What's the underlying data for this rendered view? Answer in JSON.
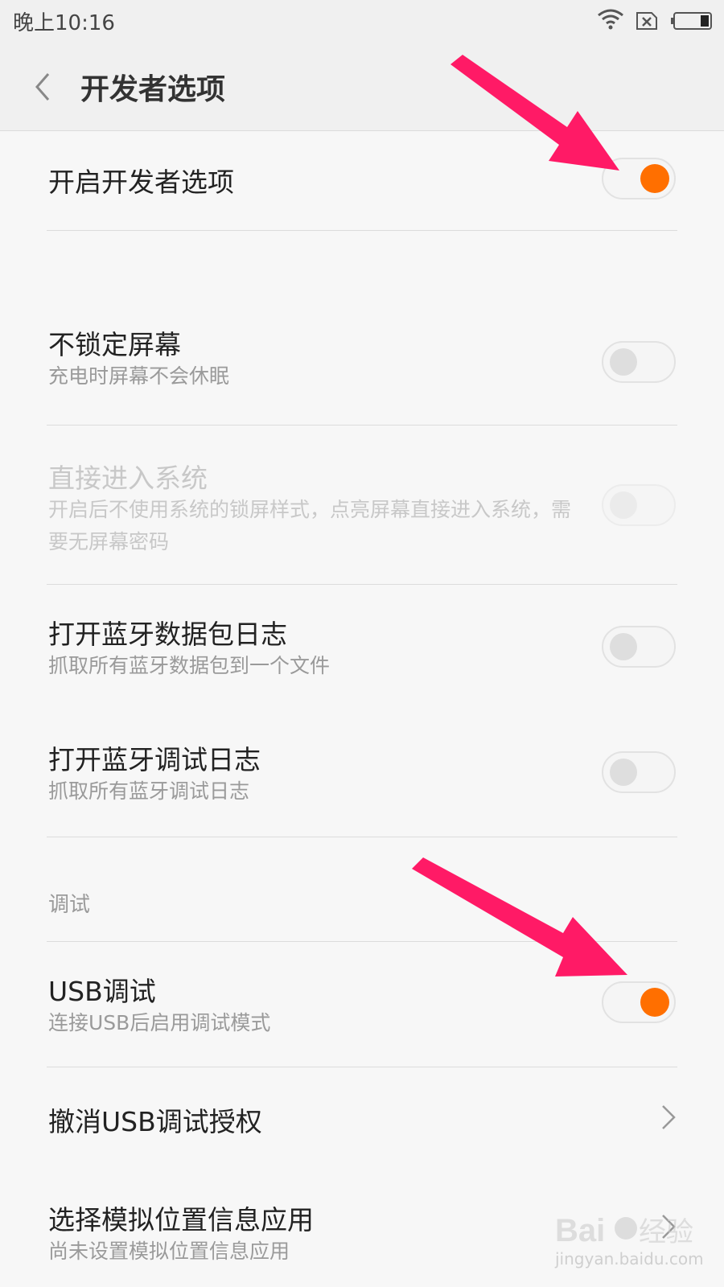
{
  "status_bar": {
    "time": "晚上10:16"
  },
  "header": {
    "title": "开发者选项"
  },
  "settings": {
    "enable_dev": {
      "label": "开启开发者选项",
      "state": "on"
    },
    "stay_awake": {
      "label": "不锁定屏幕",
      "desc": "充电时屏幕不会休眠",
      "state": "off"
    },
    "direct_entry": {
      "label": "直接进入系统",
      "desc": "开启后不使用系统的锁屏样式，点亮屏幕直接进入系统，需要无屏幕密码",
      "state": "off",
      "enabled": false
    },
    "bt_packet_log": {
      "label": "打开蓝牙数据包日志",
      "desc": "抓取所有蓝牙数据包到一个文件",
      "state": "off"
    },
    "bt_debug_log": {
      "label": "打开蓝牙调试日志",
      "desc": "抓取所有蓝牙调试日志",
      "state": "off"
    },
    "debug_section": "调试",
    "usb_debugging": {
      "label": "USB调试",
      "desc": "连接USB后启用调试模式",
      "state": "on"
    },
    "revoke_usb": {
      "label": "撤消USB调试授权"
    },
    "mock_location": {
      "label": "选择模拟位置信息应用",
      "desc": "尚未设置模拟位置信息应用"
    }
  },
  "watermark": {
    "brand": "Baidu经验",
    "url": "jingyan.baidu.com"
  },
  "colors": {
    "accent": "#ff6f00",
    "annotation_arrow": "#ff1a66"
  }
}
